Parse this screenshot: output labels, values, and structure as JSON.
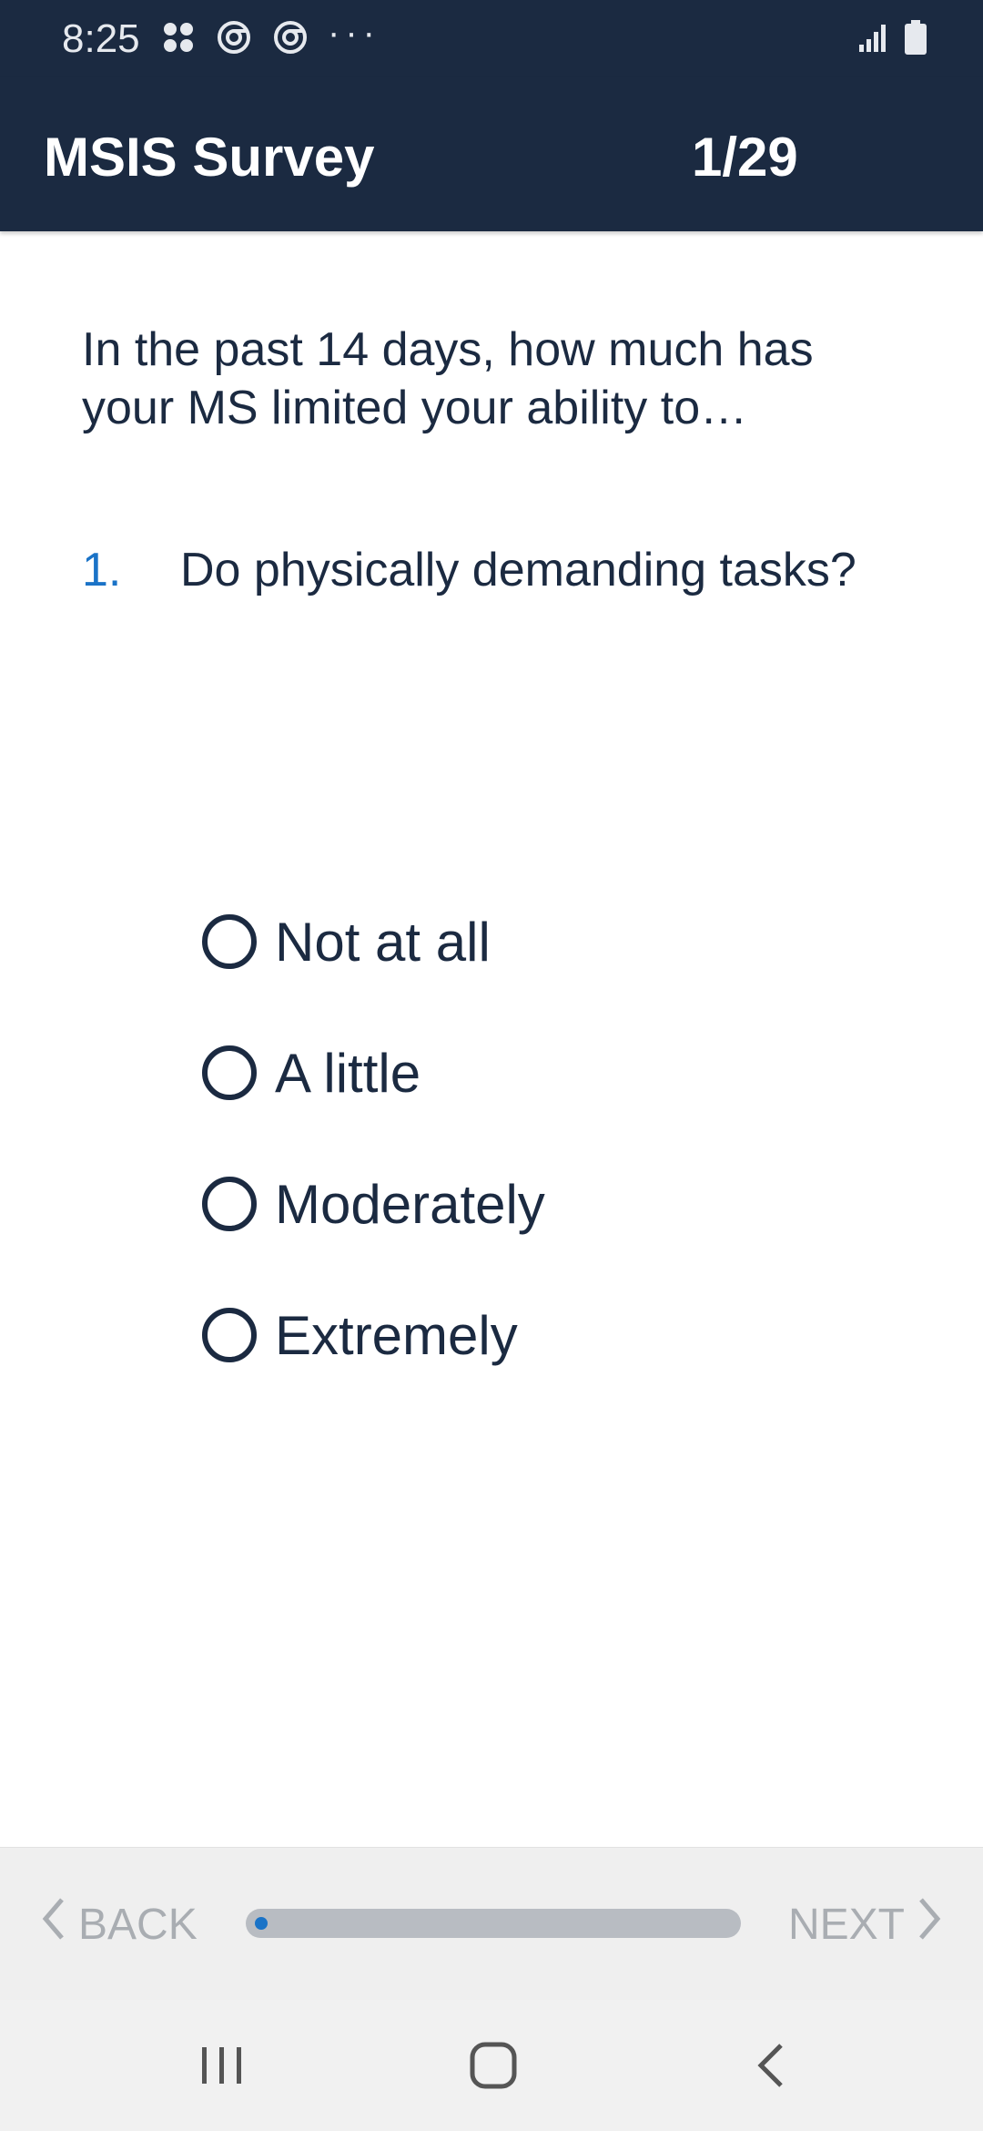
{
  "status_bar": {
    "time": "8:25",
    "dots": "···",
    "icons": [
      "apps-icon",
      "sync-icon",
      "sync-icon",
      "signal-icon",
      "battery-icon"
    ]
  },
  "app_bar": {
    "title": "MSIS Survey",
    "counter": "1/29"
  },
  "survey": {
    "intro": "In the past 14 days, how much has your MS limited your ability to…",
    "question_number": "1.",
    "question_text": "Do physically demanding tasks?",
    "options": [
      {
        "label": "Not at all",
        "selected": false
      },
      {
        "label": "A little",
        "selected": false
      },
      {
        "label": "Moderately",
        "selected": false
      },
      {
        "label": "Extremely",
        "selected": false
      }
    ]
  },
  "navigation": {
    "back_label": "BACK",
    "next_label": "NEXT",
    "progress": {
      "current": 1,
      "total": 29
    }
  },
  "colors": {
    "header_bg": "#1b2a41",
    "text": "#1b2a41",
    "accent": "#1a73c7",
    "disabled": "#a9adb2"
  }
}
